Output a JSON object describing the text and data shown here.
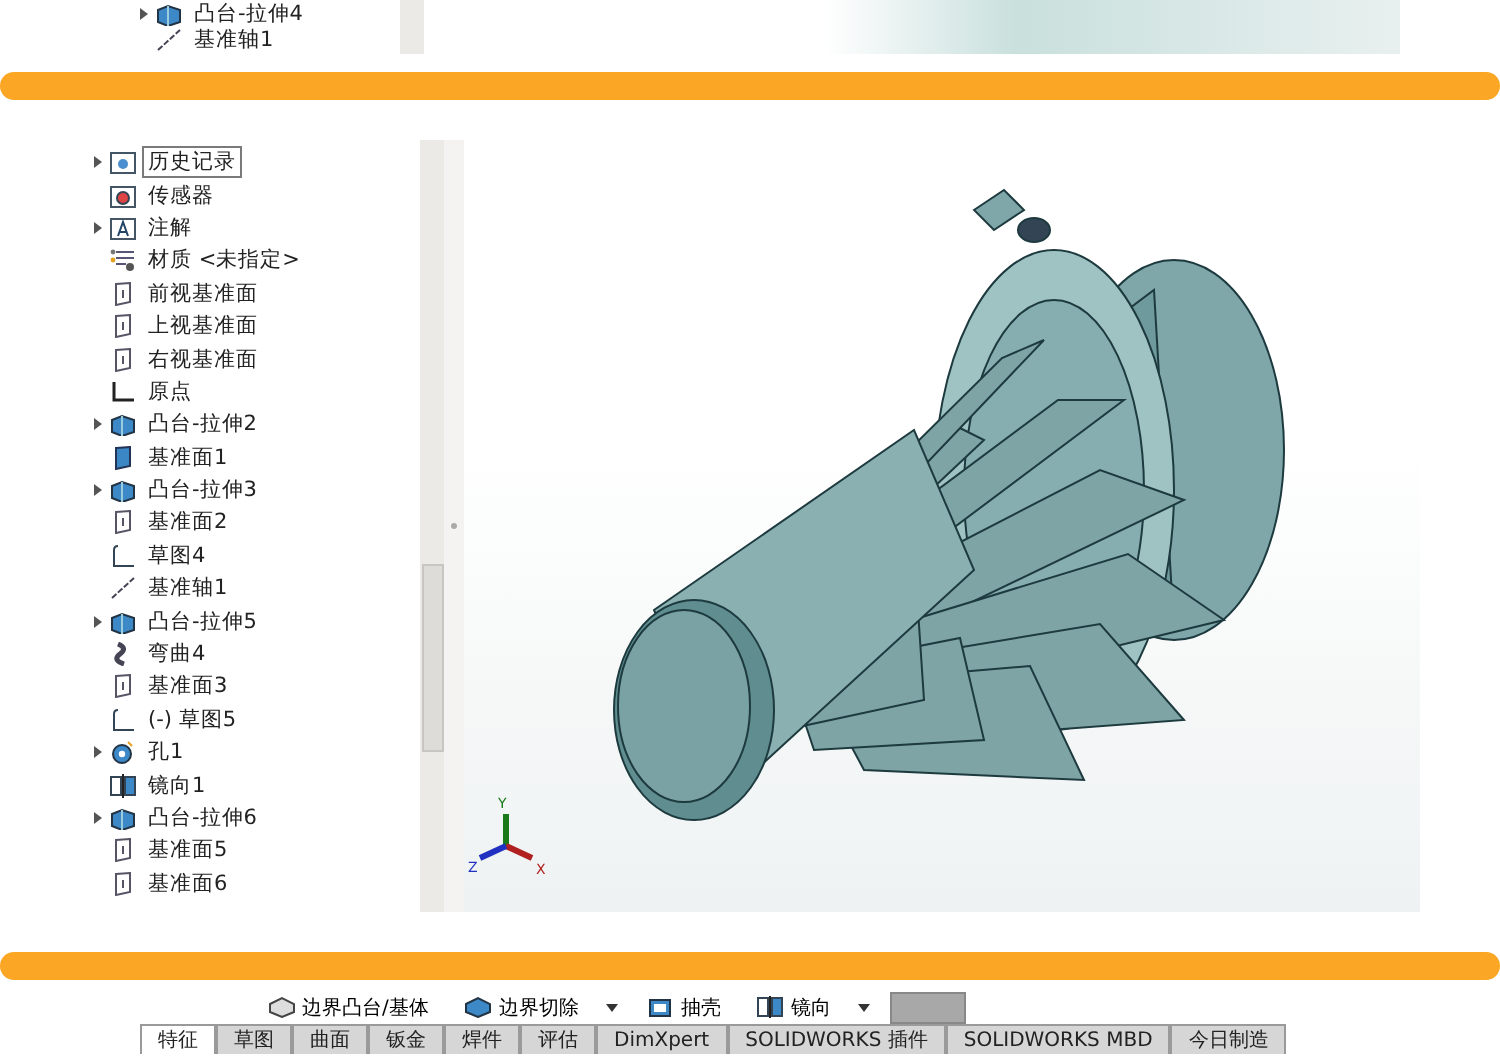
{
  "top_strip": {
    "tree_items": [
      {
        "label": "凸台-拉伸4",
        "kind": "extrude",
        "expandable": true
      },
      {
        "label": "基准轴1",
        "kind": "axis",
        "expandable": false
      }
    ]
  },
  "tree": {
    "items": [
      {
        "label": "历史记录",
        "kind": "folder",
        "expandable": true,
        "selected": true
      },
      {
        "label": "传感器",
        "kind": "sensor",
        "expandable": false,
        "selected": false
      },
      {
        "label": "注解",
        "kind": "annotation",
        "expandable": true,
        "selected": false
      },
      {
        "label": "材质 <未指定>",
        "kind": "material",
        "expandable": false,
        "selected": false
      },
      {
        "label": "前视基准面",
        "kind": "plane",
        "expandable": false,
        "selected": false
      },
      {
        "label": "上视基准面",
        "kind": "plane",
        "expandable": false,
        "selected": false
      },
      {
        "label": "右视基准面",
        "kind": "plane",
        "expandable": false,
        "selected": false
      },
      {
        "label": "原点",
        "kind": "origin",
        "expandable": false,
        "selected": false
      },
      {
        "label": "凸台-拉伸2",
        "kind": "extrude",
        "expandable": true,
        "selected": false
      },
      {
        "label": "基准面1",
        "kind": "plane_solid",
        "expandable": false,
        "selected": false
      },
      {
        "label": "凸台-拉伸3",
        "kind": "extrude",
        "expandable": true,
        "selected": false
      },
      {
        "label": "基准面2",
        "kind": "plane",
        "expandable": false,
        "selected": false
      },
      {
        "label": "草图4",
        "kind": "sketch",
        "expandable": false,
        "selected": false
      },
      {
        "label": "基准轴1",
        "kind": "axis",
        "expandable": false,
        "selected": false
      },
      {
        "label": "凸台-拉伸5",
        "kind": "extrude",
        "expandable": true,
        "selected": false
      },
      {
        "label": "弯曲4",
        "kind": "flex",
        "expandable": false,
        "selected": false
      },
      {
        "label": "基准面3",
        "kind": "plane",
        "expandable": false,
        "selected": false
      },
      {
        "label": "(-) 草图5",
        "kind": "sketch",
        "expandable": false,
        "selected": false
      },
      {
        "label": "孔1",
        "kind": "hole",
        "expandable": true,
        "selected": false
      },
      {
        "label": "镜向1",
        "kind": "mirror",
        "expandable": false,
        "selected": false
      },
      {
        "label": "凸台-拉伸6",
        "kind": "extrude",
        "expandable": true,
        "selected": false
      },
      {
        "label": "基准面5",
        "kind": "plane",
        "expandable": false,
        "selected": false
      },
      {
        "label": "基准面6",
        "kind": "plane",
        "expandable": false,
        "selected": false
      }
    ]
  },
  "viewport": {
    "axes": [
      "Y",
      "Z",
      "X"
    ]
  },
  "toolbar": {
    "buttons": [
      {
        "label": "边界凸台/基体",
        "kind": "boss"
      },
      {
        "label": "边界切除",
        "kind": "cut"
      },
      {
        "label": "抽壳",
        "kind": "shell"
      },
      {
        "label": "镜向",
        "kind": "mirror"
      }
    ]
  },
  "tabs": [
    {
      "label": "特征",
      "selected": true
    },
    {
      "label": "草图",
      "selected": false
    },
    {
      "label": "曲面",
      "selected": false
    },
    {
      "label": "钣金",
      "selected": false
    },
    {
      "label": "焊件",
      "selected": false
    },
    {
      "label": "评估",
      "selected": false
    },
    {
      "label": "DimXpert",
      "selected": false
    },
    {
      "label": "SOLIDWORKS 插件",
      "selected": false
    },
    {
      "label": "SOLIDWORKS MBD",
      "selected": false
    },
    {
      "label": "今日制造",
      "selected": false
    }
  ]
}
